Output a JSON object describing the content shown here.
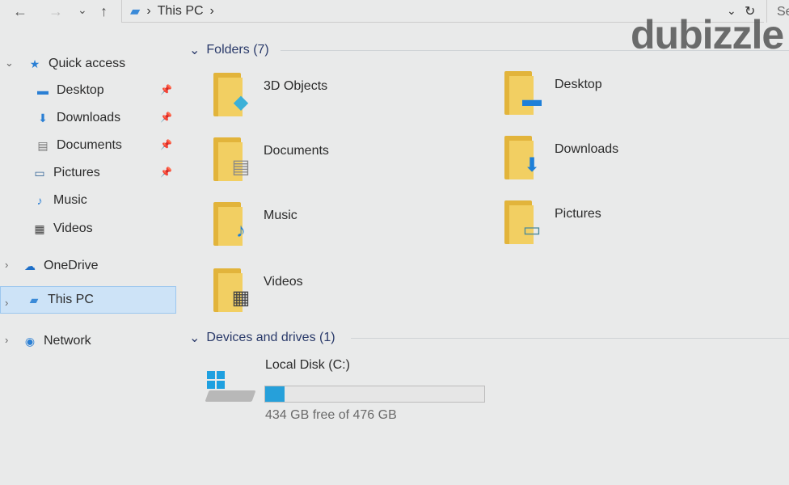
{
  "toolbar": {
    "back": "←",
    "forward": "→",
    "recent": "⌄",
    "up": "↑",
    "path": [
      "This PC"
    ],
    "sep": "›",
    "refresh": "↻",
    "dropdown": "⌄",
    "search_placeholder": "Se"
  },
  "watermark": "dubizzle",
  "sidebar": {
    "items": [
      {
        "label": "Quick access",
        "icon": "star-icon",
        "glyph": "★",
        "color": "#2a7fd4"
      },
      {
        "label": "Desktop",
        "icon": "desktop-icon",
        "glyph": "▬",
        "color": "#2a7fd4",
        "pinned": true
      },
      {
        "label": "Downloads",
        "icon": "download-icon",
        "glyph": "⬇",
        "color": "#2a7fd4",
        "pinned": true
      },
      {
        "label": "Documents",
        "icon": "document-icon",
        "glyph": "▤",
        "color": "#777",
        "pinned": true
      },
      {
        "label": "Pictures",
        "icon": "picture-icon",
        "glyph": "▭",
        "color": "#3a6a9a",
        "pinned": true
      },
      {
        "label": "Music",
        "icon": "music-icon",
        "glyph": "♪",
        "color": "#2a7fd4"
      },
      {
        "label": "Videos",
        "icon": "video-icon",
        "glyph": "▦",
        "color": "#444"
      },
      {
        "label": "OneDrive",
        "icon": "cloud-icon",
        "glyph": "☁",
        "color": "#1e6fc8"
      },
      {
        "label": "This PC",
        "icon": "computer-icon",
        "glyph": "▰",
        "color": "#3a8ad8",
        "selected": true
      },
      {
        "label": "Network",
        "icon": "network-icon",
        "glyph": "◉",
        "color": "#2a7fd4"
      }
    ],
    "pin_glyph": "📌",
    "expand_glyph": "›",
    "collapse_glyph": "⌄"
  },
  "main": {
    "folders_header": "Folders (7)",
    "folders": [
      {
        "label": "3D Objects",
        "icon": "3d-objects-icon",
        "glyph": "◆",
        "color": "#3bb0d8"
      },
      {
        "label": "Desktop",
        "icon": "desktop-icon",
        "glyph": "▬",
        "color": "#1e7fd8"
      },
      {
        "label": "Documents",
        "icon": "document-icon",
        "glyph": "▤",
        "color": "#888"
      },
      {
        "label": "Downloads",
        "icon": "download-icon",
        "glyph": "⬇",
        "color": "#1e7fd8"
      },
      {
        "label": "Music",
        "icon": "music-icon",
        "glyph": "♪",
        "color": "#1e7fd8"
      },
      {
        "label": "Pictures",
        "icon": "picture-icon",
        "glyph": "▭",
        "color": "#4a8a9a"
      },
      {
        "label": "Videos",
        "icon": "video-icon",
        "glyph": "▦",
        "color": "#444"
      }
    ],
    "devices_header": "Devices and drives (1)",
    "drive": {
      "label": "Local Disk (C:)",
      "free_text": "434 GB free of 476 GB",
      "used_fraction": 0.088,
      "bar_color": "#26a0da"
    }
  }
}
